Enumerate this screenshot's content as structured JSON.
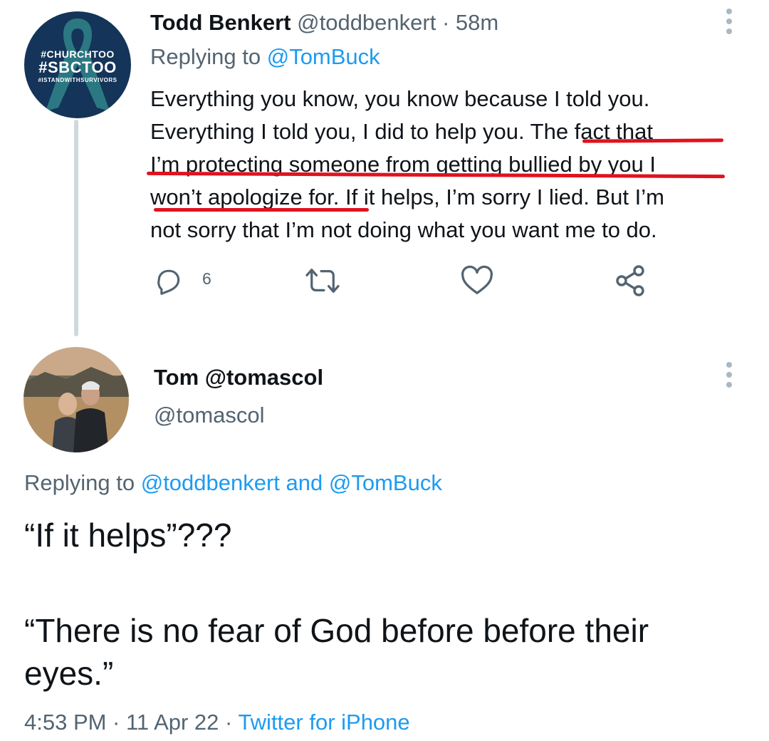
{
  "tweet1": {
    "display_name": "Todd Benkert",
    "handle": "@toddbenkert",
    "separator": "·",
    "time": "58m",
    "replying_prefix": "Replying to",
    "replying_mention": "@TomBuck",
    "avatar_tags": [
      "#CHURCHTOO",
      "#SBCTOO",
      "#ISTANDWITHSURVIVORS"
    ],
    "body_lines": [
      "Everything you know, you know because I told you.",
      "Everything I told you, I did to help you. The fact that",
      "I’m protecting someone from getting bullied by you I",
      "won’t apologize for. If it helps, I’m sorry I lied. But I’m",
      "not sorry that I’m not doing what you want me to do."
    ],
    "reply_count": "6",
    "icons": [
      "reply-icon",
      "retweet-icon",
      "like-icon",
      "share-icon",
      "more-icon"
    ],
    "underline_color": "#e0121f"
  },
  "tweet2": {
    "name_line": "Tom @tomascol",
    "handle_line": "@tomascol",
    "replying_prefix": "Replying to",
    "replying_mentions": "@toddbenkert and @TomBuck",
    "body_line1": "“If it helps”???",
    "body_line2": "“There is no fear of God before before their eyes.”",
    "timestamp": "4:53 PM · 11 Apr 22",
    "meta_separator": "·",
    "source": "Twitter for iPhone"
  },
  "colors": {
    "text": "#0f1419",
    "secondary": "#536471",
    "accent": "#1d9bf0",
    "thread_line": "#cfd9de",
    "avatar1_bg": "#143459",
    "ribbon": "#2d7f86"
  }
}
